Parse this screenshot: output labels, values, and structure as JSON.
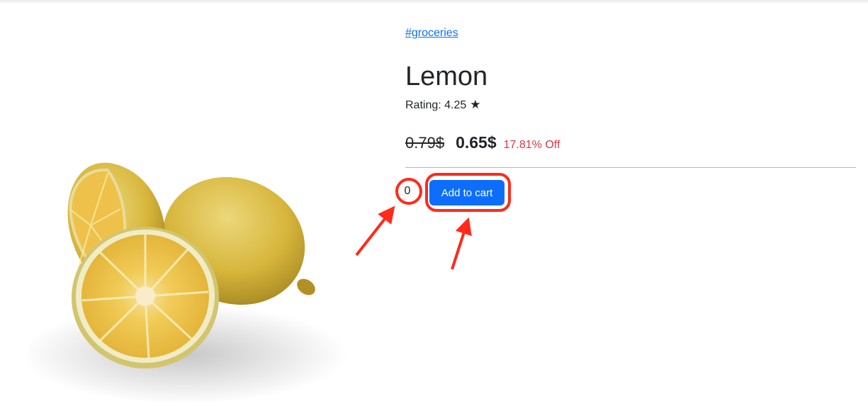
{
  "product": {
    "category_link": "#groceries",
    "title": "Lemon",
    "rating_label": "Rating: 4.25",
    "rating_star": "★",
    "old_price": "0.79$",
    "new_price": "0.65$",
    "discount": "17.81% Off",
    "image_icon": "lemon-photo"
  },
  "cart": {
    "quantity": "0",
    "add_to_cart_label": "Add to cart"
  },
  "colors": {
    "link": "#0d6efd",
    "button": "#0d6efd",
    "discount": "#dc3545",
    "annotation": "#ff2a1a"
  }
}
